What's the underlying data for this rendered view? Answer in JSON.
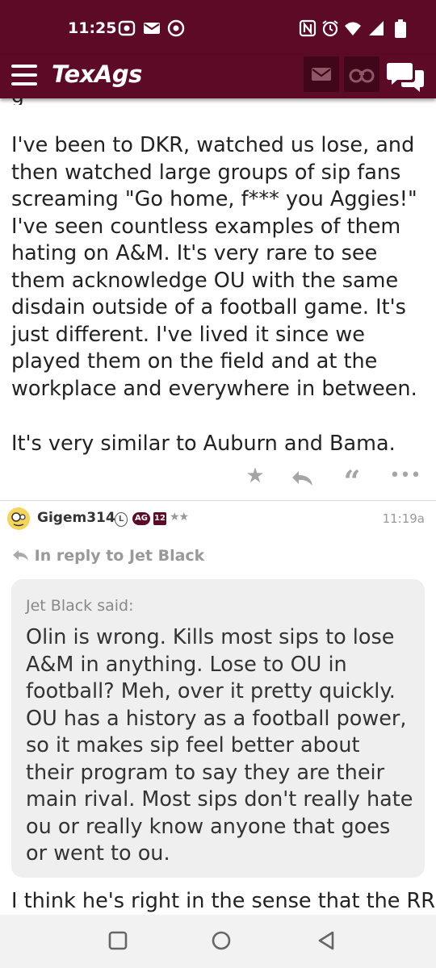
{
  "status_bar": {
    "time": "11:25"
  },
  "app": {
    "logo": "TexAgs"
  },
  "post_top": {
    "paragraph1": "I've been to DKR, watched us lose, and then watched large groups of sip fans screaming \"Go home, f*** you Aggies!\" I've seen countless examples of them hating on A&M. It's very rare to see them acknowledge OU with the same disdain outside of a football game. It's just different. I've lived it since we played them on the field and at the workplace and everywhere in between.",
    "paragraph2": "It's very similar to Auburn and Bama."
  },
  "reply": {
    "username": "Gigem314",
    "badges": [
      "L",
      "AG",
      "12"
    ],
    "stars": "★★",
    "time": "11:19a",
    "in_reply_to": "In reply to Jet Black",
    "quote_label": "Jet Black said:",
    "quote_text": "Olin is wrong. Kills most sips to lose A&M in anything. Lose to OU in football? Meh, over it pretty quickly. OU has a history as a football power, so it makes sip feel better about their program to say they are their main rival. Most sips don't really hate ou or really know anyone that goes or went to ou.",
    "body_start": "I think he's right in the sense that the RRS"
  },
  "colors": {
    "maroon": "#5c0a25",
    "dark_maroon": "#3f0719"
  },
  "icons": [
    "menu-icon",
    "mail-icon",
    "binoculars-icon",
    "chat-icon",
    "star-icon",
    "reply-icon",
    "quote-icon",
    "more-icon",
    "back-icon",
    "home-icon",
    "recents-icon"
  ]
}
